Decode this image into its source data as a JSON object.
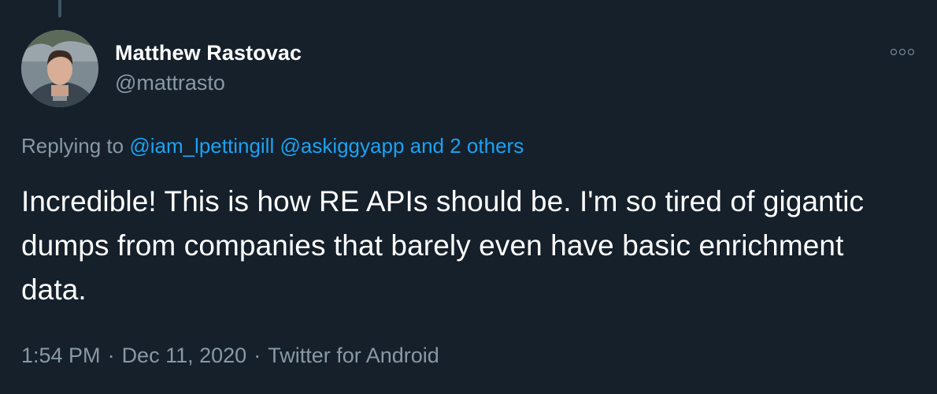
{
  "author": {
    "display_name": "Matthew Rastovac",
    "handle": "@mattrasto"
  },
  "icons": {
    "more": "more-options-icon",
    "avatar": "profile-photo"
  },
  "reply": {
    "prefix": "Replying to",
    "mention_1": "@iam_lpettingill",
    "mention_2": "@askiggyapp",
    "others": "and 2 others"
  },
  "tweet": {
    "text": "Incredible! This is how RE APIs should be. I'm so tired of gigantic dumps from companies that barely even have basic enrichment data."
  },
  "meta": {
    "time": "1:54 PM",
    "separator": "·",
    "date": "Dec 11, 2020",
    "source": "Twitter for Android"
  },
  "colors": {
    "background": "#15202b",
    "text_primary": "#ffffff",
    "text_secondary": "#8899a6",
    "link": "#1da1f2"
  }
}
